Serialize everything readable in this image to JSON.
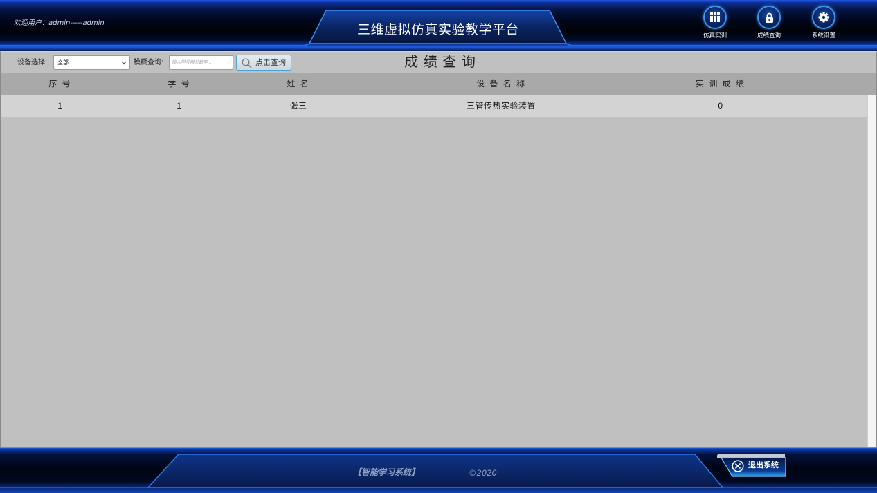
{
  "header": {
    "welcome": "欢迎用户：admin-----admin",
    "title": "三维虚拟仿真实验教学平台",
    "nav": [
      {
        "label": "仿真实训",
        "icon": "grid-icon"
      },
      {
        "label": "成绩查询",
        "icon": "lock-icon"
      },
      {
        "label": "系统设置",
        "icon": "gear-icon"
      }
    ]
  },
  "toolbar": {
    "device_label": "设备选择:",
    "device_value": "全部",
    "fuzzy_label": "模糊查询:",
    "search_placeholder": "输入学号相关数字...",
    "search_button": "点击查询",
    "search_icon": "search-icon",
    "page_title": "成 绩 查 询"
  },
  "table": {
    "columns": [
      "序 号",
      "学 号",
      "姓 名",
      "设 备 名 称",
      "实 训 成 绩"
    ],
    "rows": [
      [
        "1",
        "1",
        "张三",
        "三管传热实验装置",
        "0"
      ]
    ]
  },
  "footer": {
    "system_name": "【智能学习系统】",
    "copyright": "©2020",
    "exit_button": "退出系统",
    "exit_icon": "circle-x-icon"
  },
  "colors": {
    "accent": "#3c95ee",
    "panel": "#c0c0c0",
    "header_row": "#a9a9a9",
    "data_row": "#d3d3d3",
    "header_bg": "#000309"
  }
}
